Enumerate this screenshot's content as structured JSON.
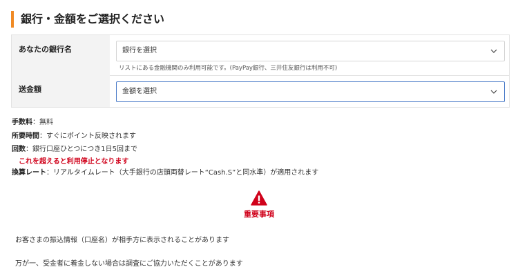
{
  "section": {
    "title": "銀行・金額をご選択ください"
  },
  "form": {
    "bank": {
      "label": "あなたの銀行名",
      "select_value": "銀行を選択",
      "note": "リストにある金融機関のみ利用可能です。(PayPay銀行、三井住友銀行は利用不可)"
    },
    "amount": {
      "label": "送金額",
      "select_value": "金額を選択"
    }
  },
  "info": {
    "fee_label": "手数料",
    "fee_value": "：無料",
    "time_label": "所要時間",
    "time_value": "：すぐにポイント反映されます",
    "count_label": "回数",
    "count_value": "：銀行口座ひとつにつき1日5回まで",
    "count_warning": "これを超えると利用停止となります",
    "rate_label": "換算レート",
    "rate_value": "：リアルタイムレート（大手銀行の店頭両替レート“Cash.S”と同水準）が適用されます"
  },
  "important": {
    "label": "重要事項",
    "icon": "warning-triangle-icon",
    "color": "#d0021b"
  },
  "notices": [
    "お客さまの振込情報（口座名）が相手方に表示されることがあります",
    "万が一、受金者に着金しない場合は調査にご協力いただくことがあります"
  ],
  "colors": {
    "accent": "#f08a24",
    "warning": "#d0021b",
    "focus_border": "#4a7bc8"
  }
}
